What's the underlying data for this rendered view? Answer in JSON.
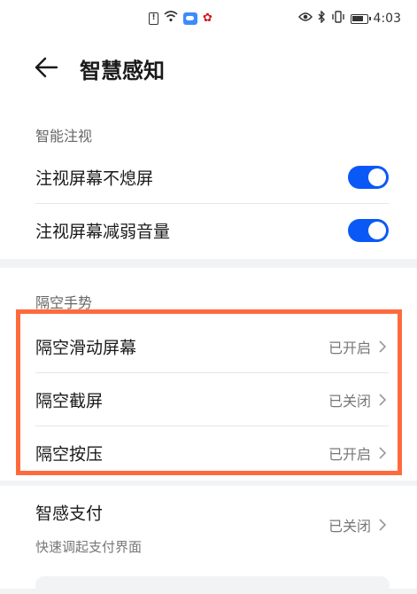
{
  "status_bar": {
    "time": "4:03",
    "sim_label": "!"
  },
  "header": {
    "title": "智慧感知"
  },
  "smart_gaze": {
    "section_title": "智能注视",
    "items": [
      {
        "label": "注视屏幕不熄屏",
        "enabled": true
      },
      {
        "label": "注视屏幕减弱音量",
        "enabled": true
      }
    ]
  },
  "air_gesture": {
    "section_title": "隔空手势",
    "items": [
      {
        "label": "隔空滑动屏幕",
        "status": "已开启"
      },
      {
        "label": "隔空截屏",
        "status": "已关闭"
      },
      {
        "label": "隔空按压",
        "status": "已开启"
      }
    ]
  },
  "smart_pay": {
    "label": "智感支付",
    "subtitle": "快速调起支付界面",
    "status": "已关闭"
  },
  "colors": {
    "accent": "#0a59f7",
    "highlight_border": "#ff6a3d"
  }
}
